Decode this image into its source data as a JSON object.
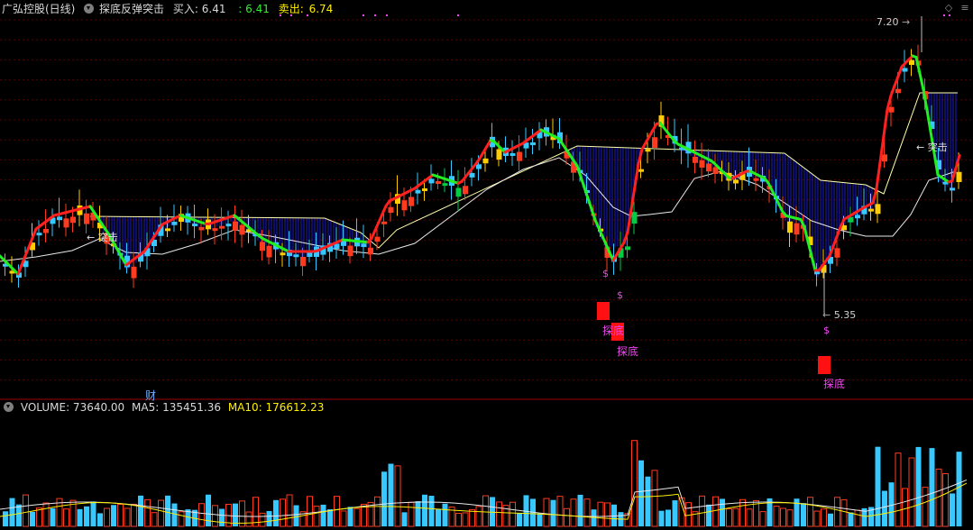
{
  "header": {
    "stock_title": "广弘控股(日线)",
    "indicator_name": "探底反弹突击",
    "buy_label": "买入:",
    "buy_value": "6.41",
    "buy_value2": ": 6.41",
    "sell_label": "卖出:",
    "sell_value": "6.74"
  },
  "volume_header": {
    "volume": "VOLUME: 73640.00",
    "ma5": "MA5: 135451.36",
    "ma10": "MA10: 176612.23"
  },
  "annotations": {
    "high_price": "7.20",
    "low_price": "5.35",
    "breakout_left": "突击",
    "breakout_right": "突击",
    "bottom_1": "探底",
    "bottom_2": "探底",
    "bottom_3": "探底",
    "dollar": "$",
    "finance_marker": "财"
  },
  "colors": {
    "up": "#ff3b1f",
    "down": "#36c8ff",
    "yellow": "#ffcc00",
    "green_up": "#00cc44",
    "ma_red": "#ff2020",
    "ma_green": "#22ee22",
    "ma_white": "#e8e8e8",
    "fill_blue": "#2020dd",
    "magenta": "#ee44ee"
  },
  "icons": {
    "collapse": "chevron-circle-icon",
    "window_restore": "restore-icon",
    "window_menu": "menu-icon"
  }
}
